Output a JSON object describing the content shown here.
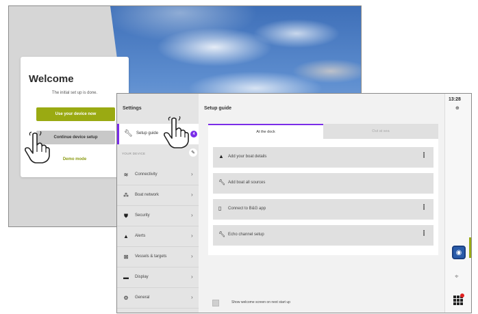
{
  "welcome": {
    "title": "Welcome",
    "subtitle": "The initial set up is done.",
    "use_device_label": "Use your device now",
    "continue_setup_label": "Continue device setup",
    "demo_mode_label": "Demo mode"
  },
  "settings": {
    "sidebar_title": "Settings",
    "active_item": {
      "label": "Setup guide",
      "badge": "4",
      "icon": "wrench-icon"
    },
    "section_label": "YOUR DEVICE",
    "items": [
      {
        "label": "Connectivity",
        "icon": "wifi-icon"
      },
      {
        "label": "Boat network",
        "icon": "network-icon"
      },
      {
        "label": "Security",
        "icon": "shield-icon"
      },
      {
        "label": "Alerts",
        "icon": "warning-icon"
      },
      {
        "label": "Vessels & targets",
        "icon": "vessel-icon"
      },
      {
        "label": "Display",
        "icon": "display-icon"
      },
      {
        "label": "General",
        "icon": "gear-icon"
      }
    ],
    "main_title": "Setup guide",
    "tabs": [
      {
        "label": "At the dock",
        "active": true
      },
      {
        "label": "Out at sea",
        "active": false
      }
    ],
    "tasks": [
      {
        "label": "Add your boat details",
        "icon": "boat-icon",
        "has_menu": true
      },
      {
        "label": "Add boat all sources",
        "icon": "wrench-icon",
        "has_menu": false
      },
      {
        "label": "Connect to B&G app",
        "icon": "phone-icon",
        "has_menu": true
      },
      {
        "label": "Echo channel setup",
        "icon": "wrench-icon",
        "has_menu": true
      }
    ],
    "footer_checkbox_label": "Show welcome screen on next start up",
    "clock": "13:28"
  },
  "colors": {
    "accent_purple": "#7a2de8",
    "brand_green": "#9aaa12",
    "nav_blue": "#2a5caa"
  }
}
